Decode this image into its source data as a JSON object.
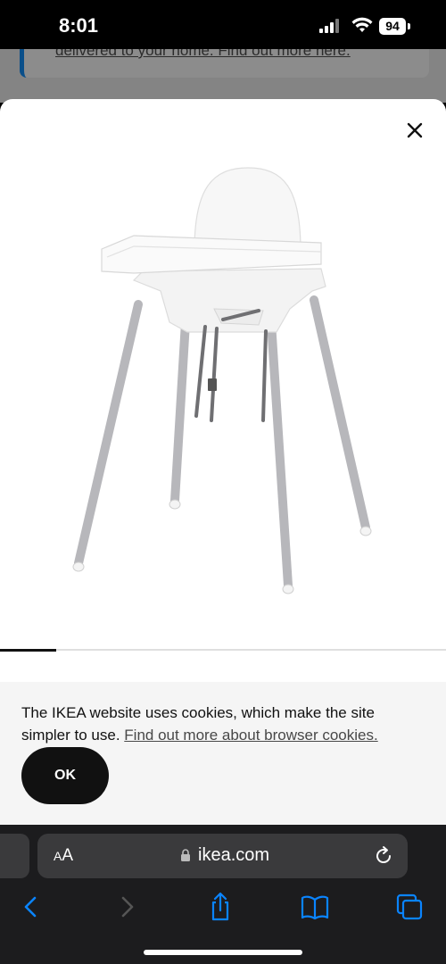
{
  "status_bar": {
    "time": "8:01",
    "battery": "94"
  },
  "background_page": {
    "link_text": "delivered to your home. Find out more here."
  },
  "product_modal": {
    "image_icon": "high-chair-image",
    "close_icon": "close-icon",
    "carousel_progress": 0.125
  },
  "cookie_banner": {
    "text": "The IKEA website uses cookies, which make the site simpler to use.",
    "link_text": "Find out more about browser cookies.",
    "ok_label": "OK"
  },
  "browser": {
    "aa_label_large": "A",
    "aa_label_small": "A",
    "domain": "ikea.com",
    "toolbar": [
      "back-icon",
      "forward-icon",
      "share-icon",
      "bookmarks-icon",
      "tabs-icon"
    ]
  },
  "colors": {
    "link_blue": "#0a84ff",
    "ikea_blue": "#0a4f8a"
  }
}
